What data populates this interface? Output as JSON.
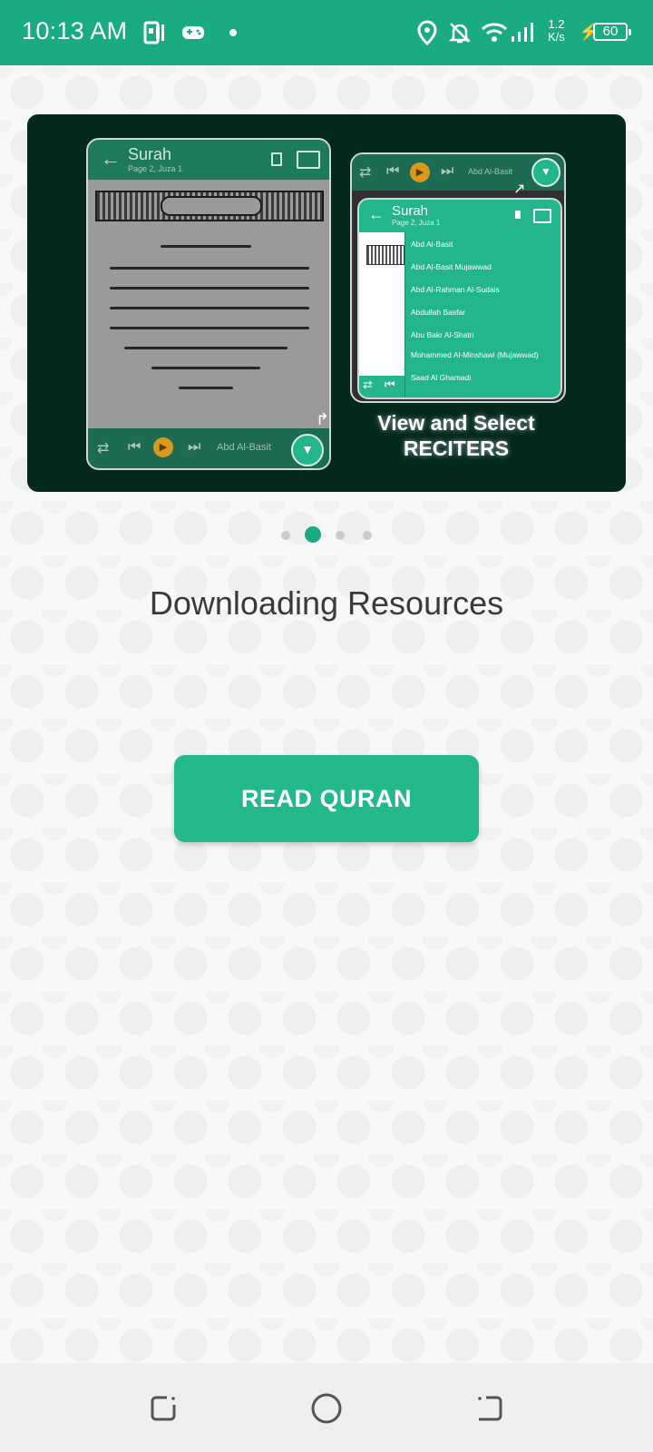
{
  "status_bar": {
    "time": "10:13 AM",
    "speed_value": "1.2",
    "speed_unit": "K/s",
    "battery": "60",
    "icons": [
      "pdf-app-icon",
      "game-controller-icon",
      "dot-icon",
      "location-icon",
      "bell-off-icon",
      "wifi-icon",
      "signal-icon",
      "charging-icon",
      "battery-icon"
    ],
    "bg_color": "#1bab82"
  },
  "banner": {
    "left_phone": {
      "title": "Surah",
      "subtitle": "Page 2, Juza 1",
      "reciter": "Abd Al-Basit"
    },
    "right_phone": {
      "reciter_top": "Abd Al-Basit",
      "title": "Surah",
      "subtitle": "Page 2, Juza 1",
      "reciters": [
        "Abd Al-Basit",
        "Abd Al-Basit Mujawwad",
        "Abd Al-Rahman Al-Sudais",
        "Abdullah Basfar",
        "Abu Bakr Al-Shatri",
        "Mohammed Al-Minshawi (Mujawwad)",
        "Saad Al Ghamadi"
      ]
    },
    "caption_line1": "View and Select",
    "caption_line2": "RECITERS"
  },
  "pager": {
    "count": 4,
    "active_index": 1
  },
  "main": {
    "heading": "Downloading Resources",
    "read_button": "READ QURAN",
    "accent_color": "#24b88d"
  },
  "nav_bar": {
    "buttons": [
      "recent-apps-icon",
      "home-icon",
      "back-icon"
    ]
  }
}
